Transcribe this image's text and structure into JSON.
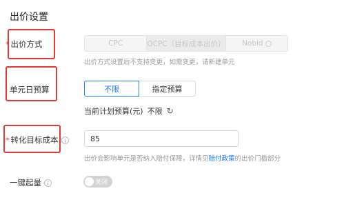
{
  "section": {
    "title": "出价设置"
  },
  "bid_method": {
    "label": "出价方式",
    "required_mark": "*",
    "options": [
      "CPC",
      "OCPC（目标成本出价）",
      "Nobid"
    ],
    "hint": "出价方式设置后不支持变更，如需变更，请新建单元"
  },
  "daily_budget": {
    "label": "单元日预算",
    "options": [
      "不限",
      "指定预算"
    ],
    "current_label": "当前计划预算(元)",
    "current_value": "不限"
  },
  "target_cost": {
    "label": "转化目标成本",
    "required_mark": "*",
    "value": "85",
    "hint_before": "出价会影响单元是否纳入赔付保障，详情见",
    "hint_link": "赔付政策",
    "hint_after": "的出价门槛部分"
  },
  "one_click": {
    "label": "一键起量",
    "toggle_text": "关闭"
  },
  "colors": {
    "highlight": "#e53935",
    "primary": "#1677ff"
  }
}
